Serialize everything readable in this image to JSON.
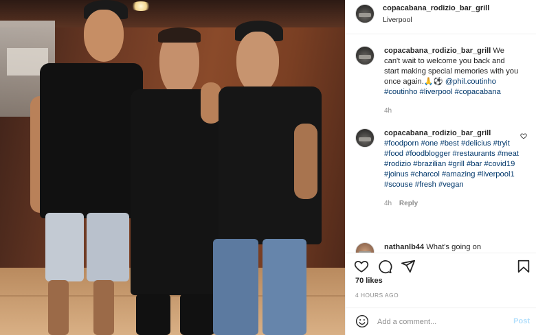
{
  "post": {
    "account": "copacabana_rodizio_bar_grill",
    "location": "Liverpool"
  },
  "comments": [
    {
      "user": "copacabana_rodizio_bar_grill",
      "text_before": " We can't wait to welcome you back and start making special memories with you once again.🙏⚽ ",
      "mention": "@phil.coutinho",
      "tags": "#coutinho #liverpool #copacabana",
      "time": "4h"
    },
    {
      "user": "copacabana_rodizio_bar_grill",
      "tags": "#foodporn #one #best #delicius #tryit #food #foodblogger #restaurants #meat #rodizio #brazilian #grill #bar #covid19 #joinus #charcol #amazing #liverpool1 #scouse #fresh #vegan",
      "time": "4h",
      "reply": "Reply"
    },
    {
      "user": "nathanlb44",
      "text": "What's going on"
    }
  ],
  "likes": "70 likes",
  "timestamp": "4 HOURS AGO",
  "add_comment": {
    "placeholder": "Add a comment...",
    "post_label": "Post"
  },
  "icons": {
    "like": "heart-icon",
    "comment": "comment-icon",
    "share": "share-icon",
    "save": "bookmark-icon",
    "emoji": "emoji-icon"
  },
  "colors": {
    "link": "#00376b",
    "muted": "#8e8e8e",
    "post_button": "#b2dffc"
  }
}
